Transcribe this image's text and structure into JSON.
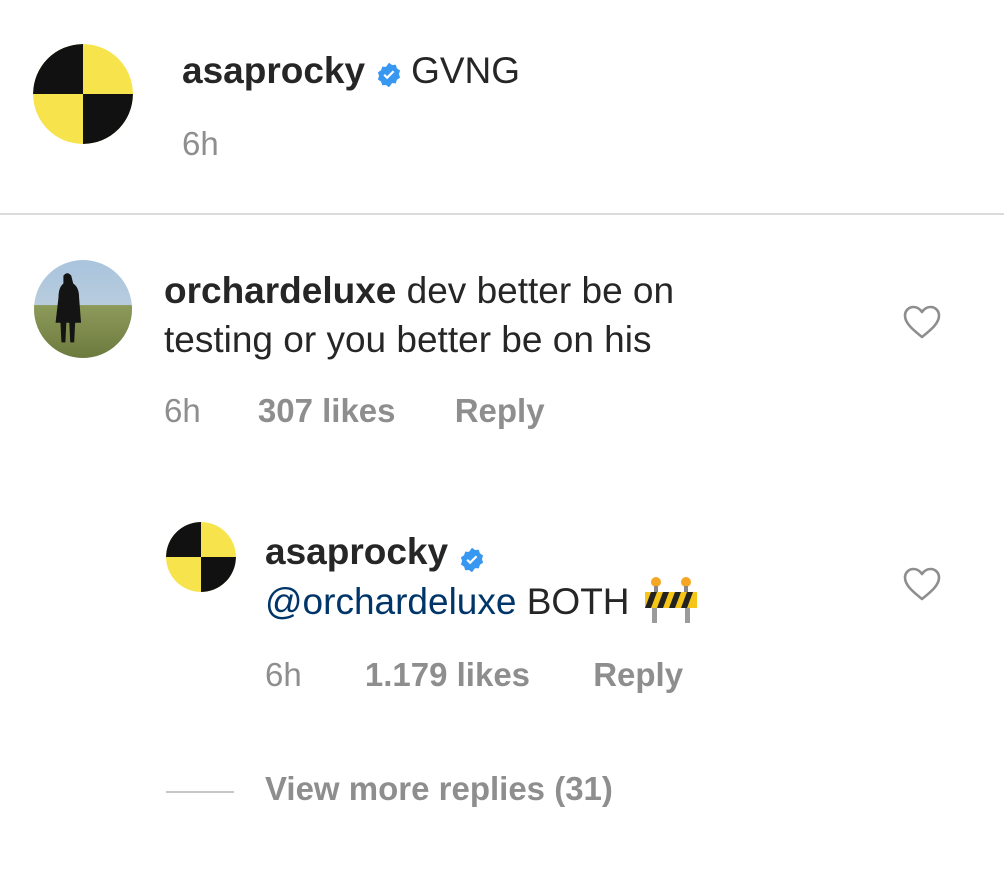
{
  "caption": {
    "username": "asaprocky",
    "text": "GVNG",
    "time": "6h",
    "verified_icon": "verified-badge-icon"
  },
  "comment": {
    "username": "orchardeluxe",
    "text_line1": "dev better be on",
    "text_line2": "testing or you better be on his",
    "time": "6h",
    "likes": "307 likes",
    "reply": "Reply",
    "like_icon": "heart-outline-icon"
  },
  "reply_comment": {
    "username": "asaprocky",
    "mention": "@orchardeluxe",
    "text": "BOTH",
    "emoji_icon": "construction-barrier-icon",
    "time": "6h",
    "likes": "1.179 likes",
    "reply": "Reply",
    "like_icon": "heart-outline-icon"
  },
  "view_more": "View more replies (31)",
  "colors": {
    "verified_blue": "#3897f0",
    "meta_gray": "#8e8e8e",
    "mention_blue": "#003569",
    "avatar_yellow": "#f7e34b",
    "avatar_black": "#111111"
  }
}
